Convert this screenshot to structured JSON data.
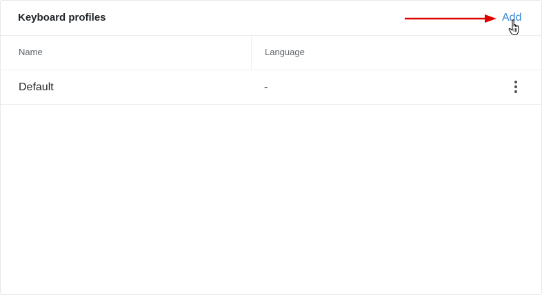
{
  "panel": {
    "title": "Keyboard profiles",
    "add_label": "Add"
  },
  "table": {
    "columns": [
      "Name",
      "Language"
    ],
    "rows": [
      {
        "name": "Default",
        "language": "-"
      }
    ]
  },
  "icons": {
    "row_menu": "kebab-menu-icon",
    "pointer": "hand-pointer-cursor-icon",
    "annotation": "red-arrow-icon"
  },
  "colors": {
    "accent": "#3a86d4",
    "annotation": "#e00000",
    "text": "#22262a",
    "muted": "#5b6168",
    "border": "#eceef0"
  }
}
